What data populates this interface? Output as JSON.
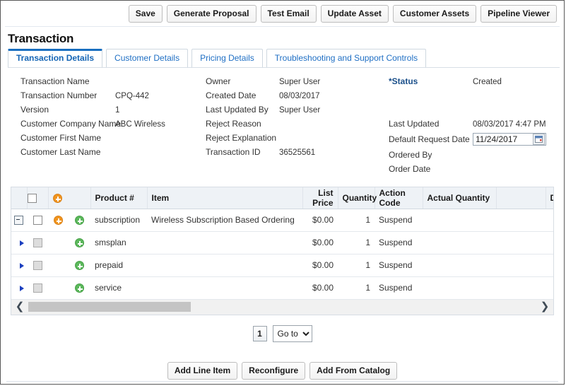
{
  "toolbar": {
    "buttons": [
      {
        "label": "Save",
        "name": "save-button"
      },
      {
        "label": "Generate Proposal",
        "name": "generate-proposal-button"
      },
      {
        "label": "Test Email",
        "name": "test-email-button"
      },
      {
        "label": "Update Asset",
        "name": "update-asset-button"
      },
      {
        "label": "Customer Assets",
        "name": "customer-assets-button"
      },
      {
        "label": "Pipeline Viewer",
        "name": "pipeline-viewer-button"
      }
    ]
  },
  "page": {
    "title": "Transaction"
  },
  "tabs": [
    {
      "label": "Transaction Details",
      "active": true
    },
    {
      "label": "Customer Details",
      "active": false
    },
    {
      "label": "Pricing Details",
      "active": false
    },
    {
      "label": "Troubleshooting and Support Controls",
      "active": false
    }
  ],
  "details": {
    "column_left": [
      {
        "label": "Transaction Name",
        "value": ""
      },
      {
        "label": "Transaction Number",
        "value": "CPQ-442"
      },
      {
        "label": "Version",
        "value": "1"
      },
      {
        "label": "Customer Company Name",
        "value": "ABC Wireless"
      },
      {
        "label": "Customer First Name",
        "value": ""
      },
      {
        "label": "Customer Last Name",
        "value": ""
      }
    ],
    "column_middle": [
      {
        "label": "Owner",
        "value": "Super User"
      },
      {
        "label": "Created Date",
        "value": "08/03/2017"
      },
      {
        "label": "Last Updated By",
        "value": "Super User"
      },
      {
        "label": "Reject Reason",
        "value": ""
      },
      {
        "label": "Reject Explanation",
        "value": ""
      },
      {
        "label": "Transaction ID",
        "value": "36525561"
      }
    ],
    "column_right": {
      "status_label": "*Status",
      "status_value": "Created",
      "last_updated_label": "Last Updated",
      "last_updated_value": "08/03/2017 4:47 PM",
      "default_request_date_label": "Default Request Date",
      "default_request_date_value": "11/24/2017",
      "calendar_icon": "calendar-icon",
      "ordered_by_label": "Ordered By",
      "ordered_by_value": "",
      "order_date_label": "Order Date",
      "order_date_value": ""
    }
  },
  "grid": {
    "header_add_icon": "add-circle-orange-icon",
    "columns": [
      {
        "label": "Product #",
        "align": "left"
      },
      {
        "label": "Item",
        "align": "left"
      },
      {
        "label": "List Price",
        "align": "right"
      },
      {
        "label": "Quantity",
        "align": "right"
      },
      {
        "label": "Action Code",
        "align": "left"
      },
      {
        "label": "Actual Quantity",
        "align": "left"
      },
      {
        "label": "Discount",
        "align": "right"
      }
    ],
    "rows": [
      {
        "type": "parent",
        "expander": "collapse-minus-icon",
        "checkbox_enabled": true,
        "icons": [
          "add-circle-orange-icon",
          "add-circle-green-icon"
        ],
        "product": "subscription",
        "item": "Wireless Subscription Based Ordering",
        "list_price": "$0.00",
        "quantity": "1",
        "action_code": "Suspend",
        "actual_quantity": "",
        "discount": ""
      },
      {
        "type": "child",
        "expander": "expand-triangle-icon",
        "checkbox_enabled": false,
        "icons": [
          "add-circle-green-icon"
        ],
        "product": "smsplan",
        "item": "",
        "list_price": "$0.00",
        "quantity": "1",
        "action_code": "Suspend",
        "actual_quantity": "",
        "discount": ""
      },
      {
        "type": "child",
        "expander": "expand-triangle-icon",
        "checkbox_enabled": false,
        "icons": [
          "add-circle-green-icon"
        ],
        "product": "prepaid",
        "item": "",
        "list_price": "$0.00",
        "quantity": "1",
        "action_code": "Suspend",
        "actual_quantity": "",
        "discount": ""
      },
      {
        "type": "child",
        "expander": "expand-triangle-icon",
        "checkbox_enabled": false,
        "icons": [
          "add-circle-green-icon"
        ],
        "product": "service",
        "item": "",
        "list_price": "$0.00",
        "quantity": "1",
        "action_code": "Suspend",
        "actual_quantity": "",
        "discount": ""
      }
    ]
  },
  "scrollbar": {
    "left_arrow": "chevron-left-icon",
    "right_arrow": "chevron-right-icon",
    "thumb_percent": 32
  },
  "pager": {
    "current_page": "1",
    "goto_label": "Go to",
    "goto_options": [
      "Go to"
    ]
  },
  "bottom_buttons": [
    {
      "label": "Add Line Item",
      "name": "add-line-item-button"
    },
    {
      "label": "Reconfigure",
      "name": "reconfigure-button"
    },
    {
      "label": "Add From Catalog",
      "name": "add-from-catalog-button"
    }
  ],
  "colors": {
    "accent_blue": "#1a6fc0",
    "add_orange": "#f0941e",
    "add_green": "#5cb85c"
  }
}
